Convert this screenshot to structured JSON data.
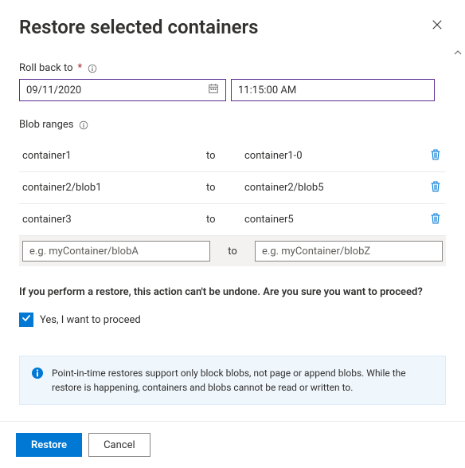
{
  "header": {
    "title": "Restore selected containers"
  },
  "rollback": {
    "label": "Roll back to",
    "date": "09/11/2020",
    "time": "11:15:00 AM"
  },
  "ranges": {
    "label": "Blob ranges",
    "to_label": "to",
    "rows": [
      {
        "from": "container1",
        "to": "container1-0"
      },
      {
        "from": "container2/blob1",
        "to": "container2/blob5"
      },
      {
        "from": "container3",
        "to": "container5"
      }
    ],
    "input": {
      "from_placeholder": "e.g. myContainer/blobA",
      "to_placeholder": "e.g. myContainer/blobZ"
    }
  },
  "confirm": {
    "warning": "If you perform a restore, this action can't be undone. Are you sure you want to proceed?",
    "checkbox_label": "Yes, I want to proceed",
    "checked": true
  },
  "note": {
    "text": "Point-in-time restores support only block blobs, not page or append blobs. While the restore is happening, containers and blobs cannot be read or written to."
  },
  "footer": {
    "primary": "Restore",
    "secondary": "Cancel"
  }
}
